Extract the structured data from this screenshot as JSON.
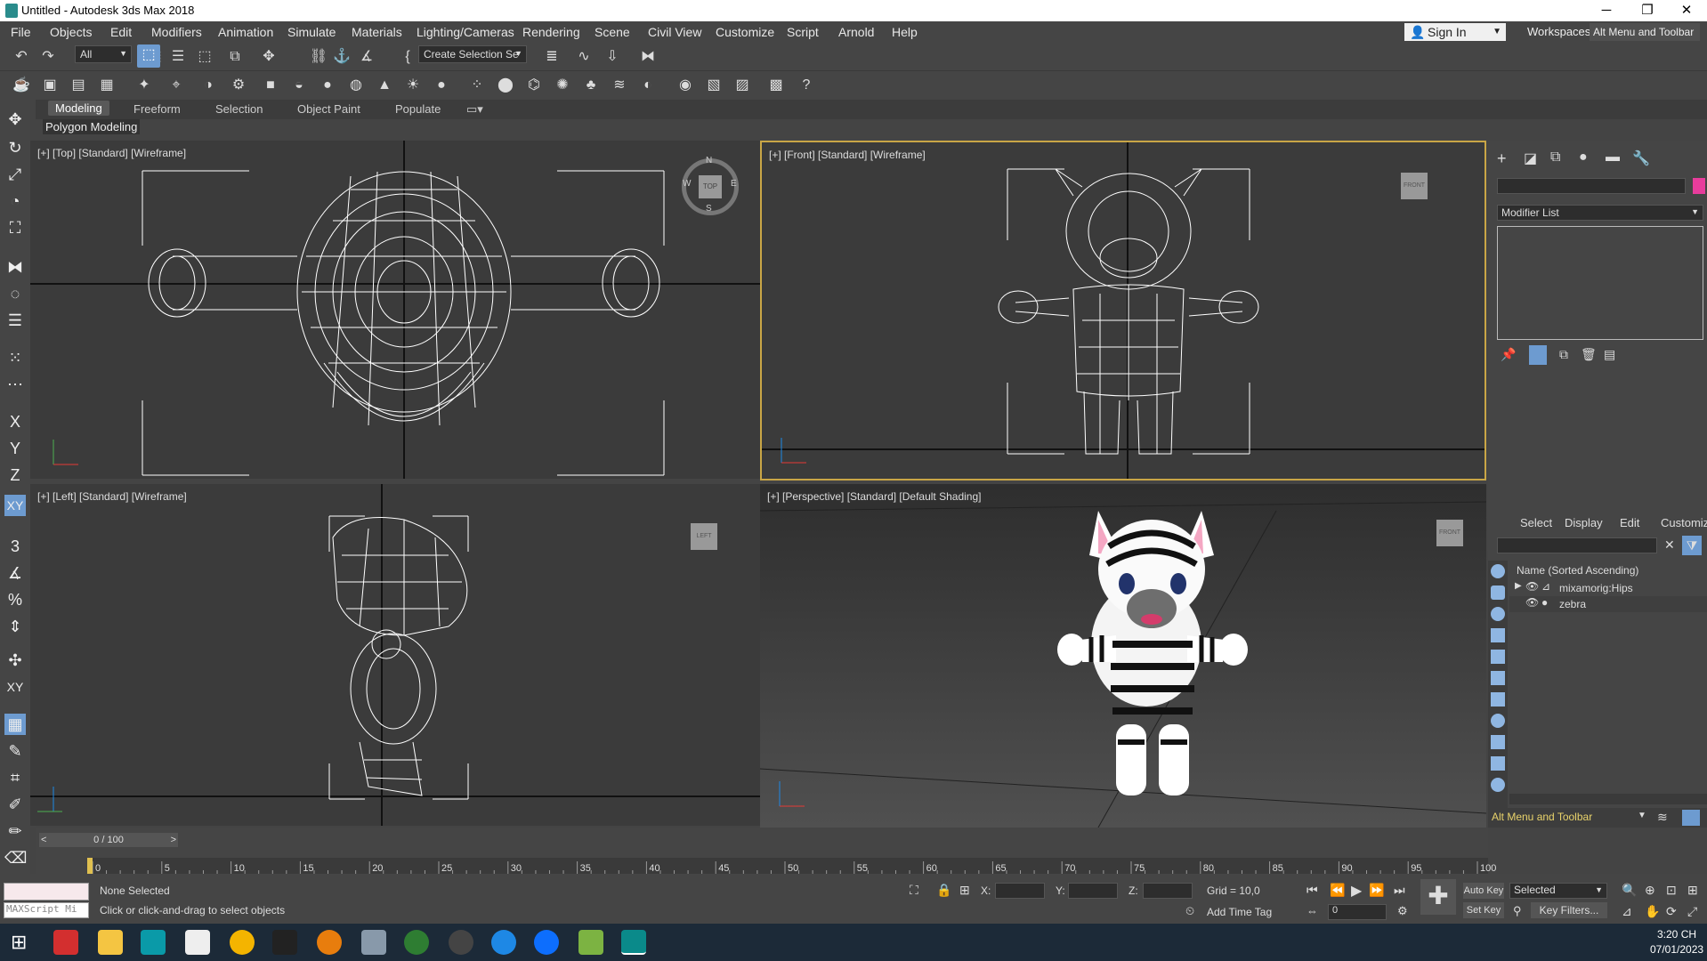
{
  "window": {
    "title": "Untitled - Autodesk 3ds Max 2018"
  },
  "menu": [
    "File",
    "Objects",
    "Edit",
    "Modifiers",
    "Animation",
    "Simulate",
    "Materials",
    "Lighting/Cameras",
    "Rendering",
    "Scene",
    "Civil View",
    "Customize",
    "Script",
    "Arnold",
    "Help"
  ],
  "account": {
    "sign_in": "Sign In",
    "workspaces_label": "Workspaces:",
    "workspace": "Alt Menu and Toolbar"
  },
  "toolbar": {
    "filter": "All",
    "selection_set": "Create Selection Se"
  },
  "ribbon": {
    "tabs": [
      "Modeling",
      "Freeform",
      "Selection",
      "Object Paint",
      "Populate"
    ],
    "subtab": "Polygon Modeling"
  },
  "left_tools": [
    "X",
    "Y",
    "Z",
    "XY"
  ],
  "viewports": {
    "top": {
      "label": "[+] [Top] [Standard] [Wireframe]",
      "cube": "TOP",
      "compass": [
        "N",
        "S",
        "E",
        "W"
      ]
    },
    "front": {
      "label": "[+] [Front] [Standard] [Wireframe]",
      "cube": "FRONT"
    },
    "left": {
      "label": "[+] [Left] [Standard] [Wireframe]",
      "cube": "LEFT"
    },
    "perspective": {
      "label": "[+] [Perspective] [Standard] [Default Shading]",
      "cube": "FRONT"
    }
  },
  "command_panel": {
    "modifier_list": "Modifier List"
  },
  "scene_explorer": {
    "tabs": [
      "Select",
      "Display",
      "Edit",
      "Customize"
    ],
    "header": "Name (Sorted Ascending)",
    "items": [
      "mixamorig:Hips",
      "zebra"
    ],
    "workspace": "Alt Menu and Toolbar"
  },
  "timeline": {
    "frame": "0 / 100",
    "ticks": [
      "0",
      "5",
      "10",
      "15",
      "20",
      "25",
      "30",
      "35",
      "40",
      "45",
      "50",
      "55",
      "60",
      "65",
      "70",
      "75",
      "80",
      "85",
      "90",
      "95",
      "100"
    ]
  },
  "status": {
    "maxscript": "MAXScript Mi",
    "selection": "None Selected",
    "prompt": "Click or click-and-drag to select objects",
    "x_label": "X:",
    "y_label": "Y:",
    "z_label": "Z:",
    "grid": "Grid = 10,0",
    "add_time_tag": "Add Time Tag",
    "auto_key": "Auto Key",
    "set_key": "Set Key",
    "selected": "Selected",
    "key_filters": "Key Filters...",
    "frame_value": "0"
  },
  "clock": {
    "time": "3:20 CH",
    "date": "07/01/2023"
  },
  "colors": {
    "accent": "#6d9bd0",
    "active_viewport": "#c9a646",
    "swatch": "#e83c9c"
  }
}
